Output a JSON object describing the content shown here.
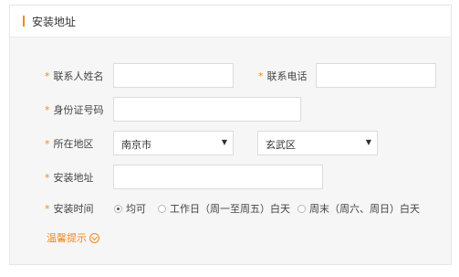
{
  "section": {
    "title": "安装地址"
  },
  "form": {
    "contact_name": {
      "label": "联系人姓名",
      "value": ""
    },
    "contact_phone": {
      "label": "联系电话",
      "value": ""
    },
    "id_number": {
      "label": "身份证号码",
      "value": ""
    },
    "region": {
      "label": "所在地区",
      "city_selected": "南京市",
      "district_selected": "玄武区"
    },
    "address": {
      "label": "安装地址",
      "value": ""
    },
    "install_time": {
      "label": "安装时间",
      "options": [
        "均可",
        "工作日（周一至周五）白天",
        "周末（周六、周日）白天"
      ],
      "selected_index": 0
    }
  },
  "tip": {
    "label": "温馨提示"
  },
  "colors": {
    "accent": "#f08a1e"
  },
  "required_marker": "*"
}
